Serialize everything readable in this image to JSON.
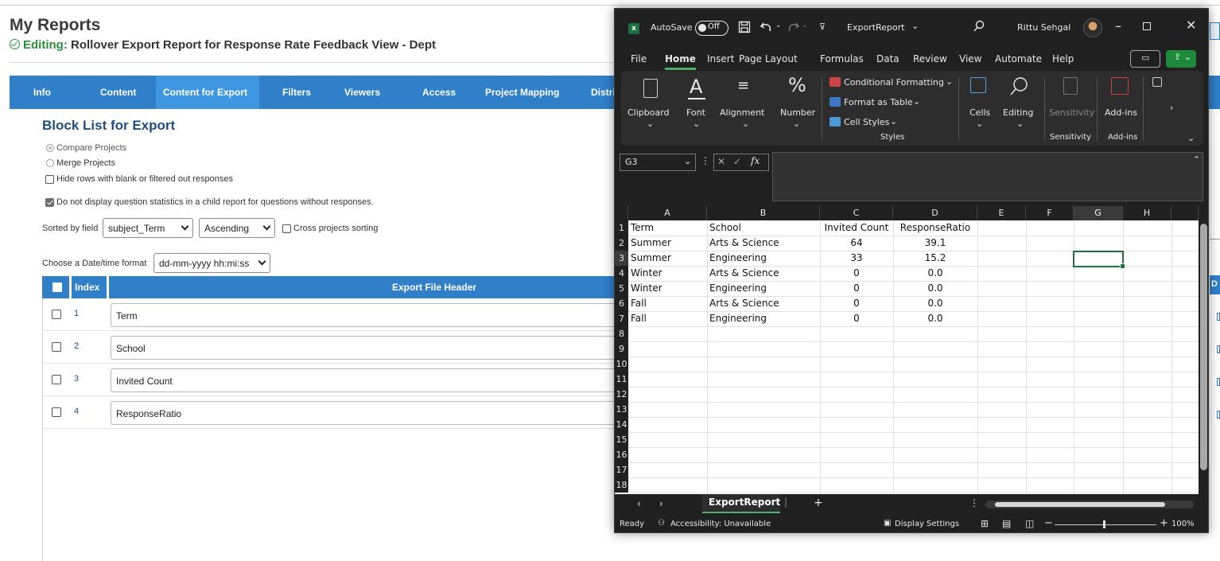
{
  "page": {
    "title": "My Reports",
    "editing_label": "Editing:",
    "editing_name": "Rollover Export Report for Response Rate Feedback View - Dept"
  },
  "nav": {
    "tabs": [
      {
        "label": "Info"
      },
      {
        "label": "Content"
      },
      {
        "label": "Content for Export",
        "active": true
      },
      {
        "label": "Filters"
      },
      {
        "label": "Viewers"
      },
      {
        "label": "Access"
      },
      {
        "label": "Project Mapping"
      },
      {
        "label": "Distri"
      }
    ]
  },
  "block": {
    "heading": "Block List for Export",
    "compare_label": "Compare Projects",
    "merge_label": "Merge Projects",
    "hide_rows_label": "Hide rows with blank or filtered out responses",
    "no_display_label": "Do not display question statistics in a child report for questions without responses.",
    "sorted_by_label": "Sorted by field",
    "sort_field": "subject_Term",
    "sort_order": "Ascending",
    "cross_sort_label": "Cross projects sorting",
    "date_format_label": "Choose a Date/time format",
    "date_format": "dd-mm-yyyy hh:mi:ss"
  },
  "grid": {
    "col_index": "Index",
    "col_header": "Export File Header",
    "rows": [
      {
        "index": "1",
        "header": "Term"
      },
      {
        "index": "2",
        "header": "School"
      },
      {
        "index": "3",
        "header": "Invited Count"
      },
      {
        "index": "4",
        "header": "ResponseRatio"
      }
    ],
    "right_edge_letter": "D"
  },
  "excel": {
    "autosave_label": "AutoSave",
    "autosave_state": "Off",
    "file_name": "ExportReport",
    "user_name": "Rittu Sehgal",
    "menu_tabs": [
      "File",
      "Home",
      "Insert",
      "Page Layout",
      "Formulas",
      "Data",
      "Review",
      "View",
      "Automate",
      "Help"
    ],
    "active_tab": "Home",
    "ribbon": {
      "clipboard": "Clipboard",
      "font": "Font",
      "alignment": "Alignment",
      "number": "Number",
      "conditional_formatting": "Conditional Formatting",
      "format_as_table": "Format as Table",
      "cell_styles": "Cell Styles",
      "styles_group": "Styles",
      "cells": "Cells",
      "editing": "Editing",
      "sensitivity": "Sensitivity",
      "sensitivity_group": "Sensitivity",
      "addins": "Add-ins",
      "addins_group": "Add-ins"
    },
    "name_box": "G3",
    "fx": "fx",
    "columns": [
      "A",
      "B",
      "C",
      "D",
      "E",
      "F",
      "G",
      "H"
    ],
    "selected_column": "G",
    "row_numbers": [
      "1",
      "2",
      "3",
      "4",
      "5",
      "6",
      "7",
      "8",
      "9",
      "10",
      "11",
      "12",
      "13",
      "14",
      "15",
      "16",
      "17",
      "18"
    ],
    "selected_row": "3",
    "cells": {
      "header": [
        "Term",
        "School",
        "Invited Count",
        "ResponseRatio"
      ],
      "data": [
        [
          "Summer",
          "Arts & Science",
          "64",
          "39.1"
        ],
        [
          "Summer",
          "Engineering",
          "33",
          "15.2"
        ],
        [
          "Winter",
          "Arts & Science",
          "0",
          "0.0"
        ],
        [
          "Winter",
          "Engineering",
          "0",
          "0.0"
        ],
        [
          "Fall",
          "Arts & Science",
          "0",
          "0.0"
        ],
        [
          "Fall",
          "Engineering",
          "0",
          "0.0"
        ]
      ]
    },
    "sheet_tab": "ExportReport",
    "status": {
      "ready": "Ready",
      "accessibility": "Accessibility: Unavailable",
      "display_settings": "Display Settings",
      "zoom": "100%"
    }
  },
  "colors": {
    "nav_blue": "#2f7fc9",
    "nav_active": "#3f97e2",
    "heading_blue": "#1f4f7f",
    "editing_green": "#2a8f3a",
    "excel_green": "#1d6f42",
    "excel_dark": "#202020"
  }
}
